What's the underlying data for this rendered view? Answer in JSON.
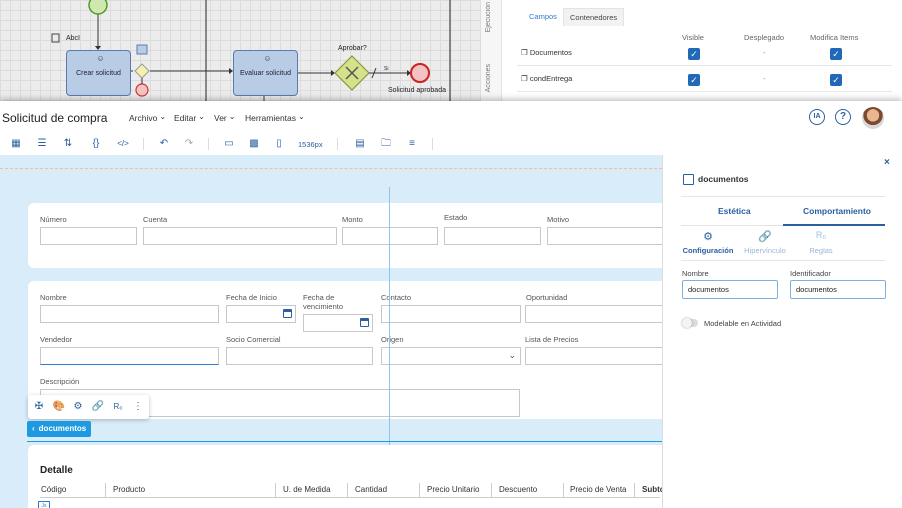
{
  "bpmn": {
    "task1": "Crear solicitud",
    "task2": "Evaluar solicitud",
    "gateway_question": "Aprobar?",
    "flow_label": "Si",
    "end_event": "Solicitud aprobada",
    "annotation": "AbcI"
  },
  "side_tabs": [
    "Ejecución",
    "Acciones"
  ],
  "properties": {
    "tabs": [
      "Campos",
      "Contenedores"
    ],
    "headers": [
      "Visible",
      "Desplegado",
      "Modifica Items"
    ],
    "rows": [
      {
        "name": "Documentos",
        "dash": "-"
      },
      {
        "name": "condEntrega",
        "dash": "-"
      }
    ]
  },
  "header": {
    "title": "Solicitud de compra",
    "menus": [
      "Archivo",
      "Editar",
      "Ver",
      "Herramientas"
    ],
    "ia_label": "IA",
    "help_label": "?"
  },
  "toolbar": {
    "zoom": "1536px"
  },
  "form": {
    "row1": [
      "Número",
      "Cuenta",
      "Monto",
      "Estado",
      "Motivo"
    ],
    "row2": [
      "Nombre",
      "Fecha de Inicio",
      "Fecha de vencimiento",
      "Contacto",
      "Oportunidad"
    ],
    "row3": [
      "Vendedor",
      "Socio Comercial",
      "Origen",
      "Lista de Precios"
    ],
    "description": "Descripción"
  },
  "selected_chip": "documentos",
  "detail": {
    "title": "Detalle",
    "columns": [
      "Código",
      "Producto",
      "U. de Medida",
      "Cantidad",
      "Precio Unitario",
      "Descuento",
      "Precio de Venta",
      "Subtotal"
    ],
    "js_label": "Js"
  },
  "panel": {
    "close": "×",
    "title": "documentos",
    "tabs": [
      "Estética",
      "Comportamiento"
    ],
    "subtabs": [
      "Configuración",
      "Hipervínculo",
      "Reglas"
    ],
    "name_label": "Nombre",
    "name_value": "documentos",
    "id_label": "Identificador",
    "id_value": "documentos",
    "toggle_label": "Modelable en Actividad"
  },
  "colors": {
    "accent": "#2a5fa0",
    "selection": "#1e9be0",
    "canvas": "#d9ecfa"
  }
}
